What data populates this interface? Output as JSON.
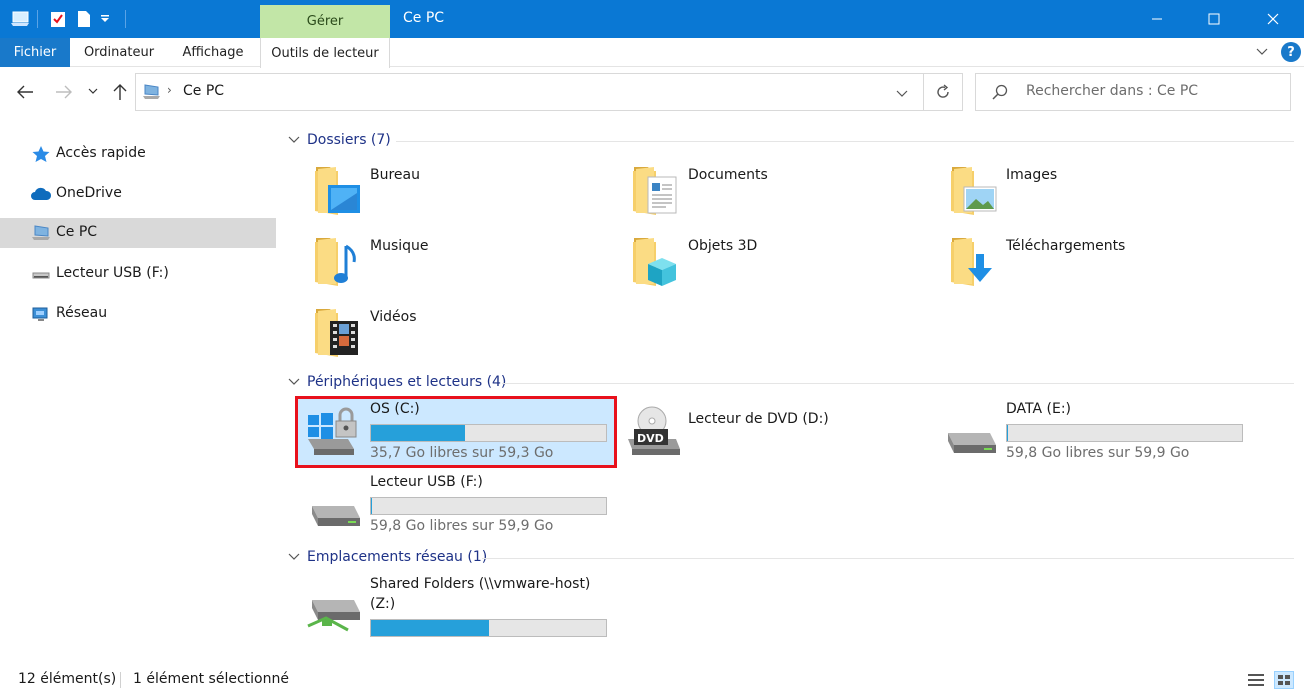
{
  "window": {
    "title": "Ce PC",
    "contextual_tab": "Gérer"
  },
  "ribbon": {
    "tabs": [
      {
        "label": "Fichier"
      },
      {
        "label": "Ordinateur"
      },
      {
        "label": "Affichage"
      },
      {
        "label": "Outils de lecteur"
      }
    ]
  },
  "address": {
    "path": "Ce PC",
    "search_placeholder": "Rechercher dans : Ce PC"
  },
  "sidebar": {
    "items": [
      {
        "label": "Accès rapide",
        "icon": "star-icon"
      },
      {
        "label": "OneDrive",
        "icon": "cloud-icon"
      },
      {
        "label": "Ce PC",
        "icon": "computer-icon",
        "selected": true
      },
      {
        "label": "Lecteur USB (F:)",
        "icon": "usb-drive-icon"
      },
      {
        "label": "Réseau",
        "icon": "network-icon"
      }
    ]
  },
  "groups": {
    "folders": {
      "title": "Dossiers (7)"
    },
    "devices": {
      "title": "Périphériques et lecteurs (4)"
    },
    "network": {
      "title": "Emplacements réseau (1)"
    }
  },
  "folders": [
    {
      "name": "Bureau",
      "overlay": "desktop"
    },
    {
      "name": "Documents",
      "overlay": "document"
    },
    {
      "name": "Images",
      "overlay": "picture"
    },
    {
      "name": "Musique",
      "overlay": "music"
    },
    {
      "name": "Objets 3D",
      "overlay": "cube"
    },
    {
      "name": "Téléchargements",
      "overlay": "download"
    },
    {
      "name": "Vidéos",
      "overlay": "film"
    }
  ],
  "drives": [
    {
      "name": "OS (C:)",
      "free_text": "35,7 Go libres sur 59,3 Go",
      "used_fraction": 0.398
    },
    {
      "name": "Lecteur de DVD (D:)"
    },
    {
      "name": "DATA (E:)",
      "free_text": "59,8 Go libres sur 59,9 Go",
      "used_fraction": 0.002
    },
    {
      "name": "Lecteur USB (F:)",
      "free_text": "59,8 Go libres sur 59,9 Go",
      "used_fraction": 0.002
    }
  ],
  "network_drives": [
    {
      "name_line1": "Shared Folders (\\\\vmware-host)",
      "name_line2": "(Z:)",
      "used_fraction": 0.5
    }
  ],
  "status": {
    "count": "12 élément(s)",
    "selection": "1 élément sélectionné"
  },
  "colors": {
    "accent": "#0a78d4",
    "progress": "#26a0da",
    "selection": "#cce8ff",
    "highlight_box": "#e8111c",
    "group_header": "#1e3287"
  }
}
